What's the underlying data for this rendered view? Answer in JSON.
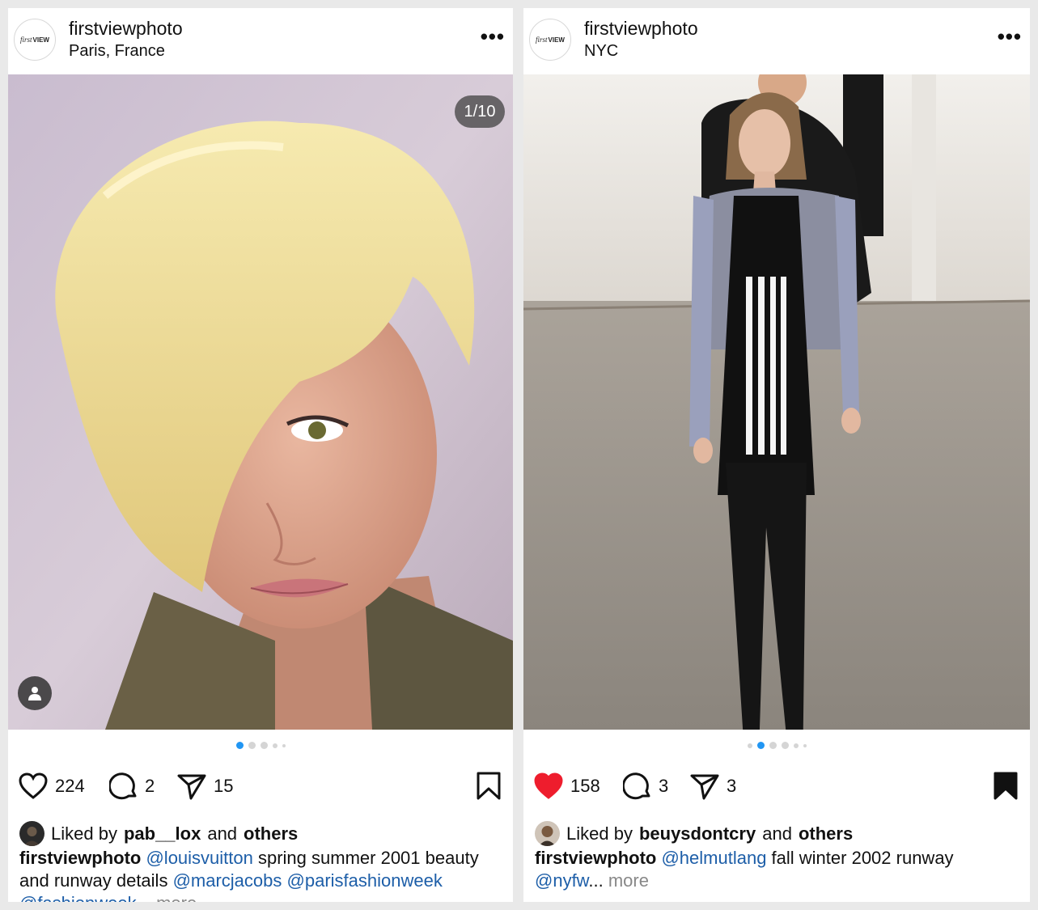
{
  "posts": [
    {
      "username": "firstviewphoto",
      "location": "Paris, France",
      "avatar_text_italic": "first",
      "avatar_text_bold": "VIEW",
      "more_label": "•••",
      "photo_description_icon": "portrait-photo",
      "counter": "1/10",
      "likes": "224",
      "comments": "2",
      "shares": "15",
      "liked_prefix": "Liked by",
      "liked_user": "pab__lox",
      "liked_and": "and",
      "liked_others": "others",
      "caption_user": "firstviewphoto",
      "caption_mention1": "@louisvuitton",
      "caption_text1": " spring summer 2001 beauty and runway details ",
      "caption_mention2": "@marcjacobs",
      "caption_mention3": "@parisfashionweek",
      "caption_mention4": "@fashionweek",
      "caption_more": "... more",
      "heart_filled": false
    },
    {
      "username": "firstviewphoto",
      "location": "NYC",
      "avatar_text_italic": "first",
      "avatar_text_bold": "VIEW",
      "more_label": "•••",
      "likes": "158",
      "comments": "3",
      "shares": "3",
      "liked_prefix": "Liked by",
      "liked_user": "beuysdontcry",
      "liked_and": "and",
      "liked_others": "others",
      "caption_user": "firstviewphoto",
      "caption_mention1": "@helmutlang",
      "caption_text1": " fall winter 2002 runway ",
      "caption_mention2": "@nyfw",
      "caption_more": "more",
      "heart_filled": true
    }
  ],
  "colors": {
    "accent": "#2196f3",
    "like_red": "#ee1d2d",
    "mention": "#1d5ea8"
  }
}
